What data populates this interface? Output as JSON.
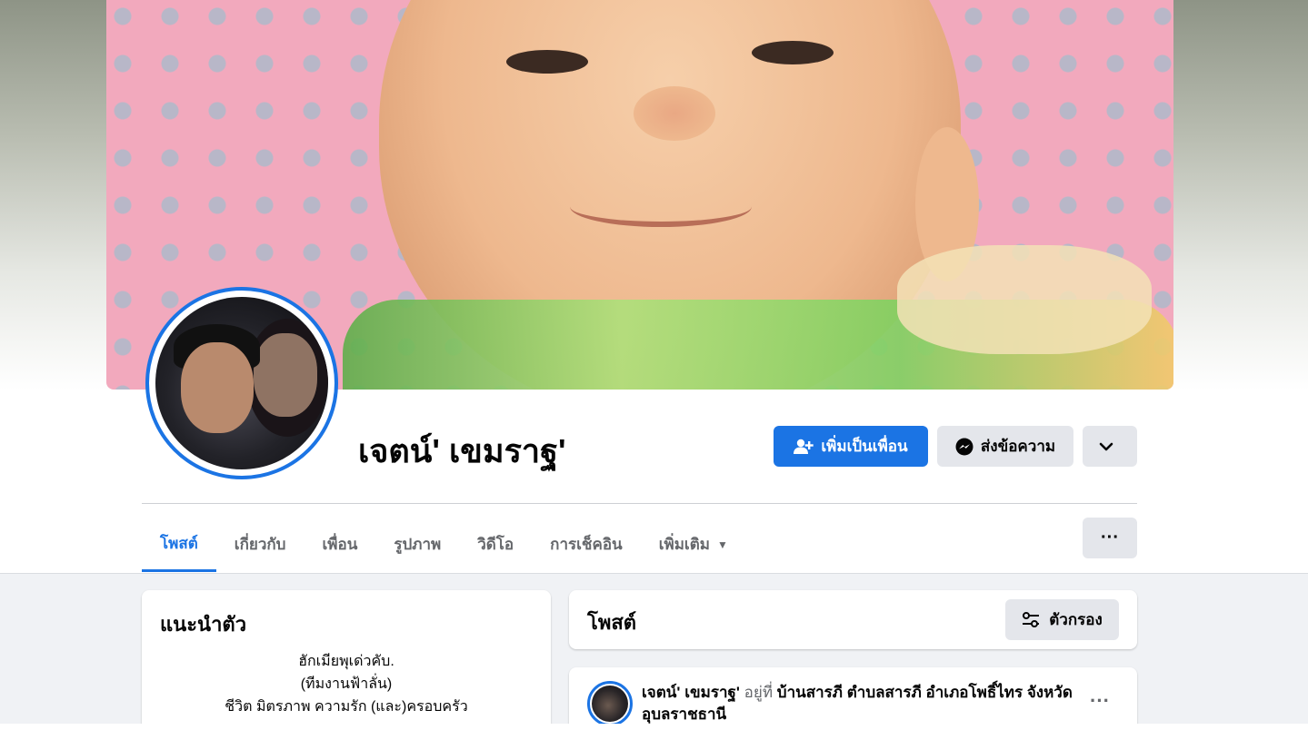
{
  "profile": {
    "name": "เจตน์' เขมราฐ'"
  },
  "actions": {
    "add_friend": "เพิ่มเป็นเพื่อน",
    "message": "ส่งข้อความ"
  },
  "tabs": [
    {
      "label": "โพสต์",
      "active": true
    },
    {
      "label": "เกี่ยวกับ"
    },
    {
      "label": "เพื่อน"
    },
    {
      "label": "รูปภาพ"
    },
    {
      "label": "วิดีโอ"
    },
    {
      "label": "การเช็คอิน"
    },
    {
      "label": "เพิ่มเติม"
    }
  ],
  "intro": {
    "title": "แนะนำตัว",
    "lines": [
      "ฮักเมียพุเด่วคับ.",
      "(ทีมงานฟ้าลั่น)",
      "ชีวิต มิตรภาพ ความรัก (และ)ครอบครัว"
    ]
  },
  "posts": {
    "title": "โพสต์",
    "filter_label": "ตัวกรอง"
  },
  "post": {
    "author": "เจตน์' เขมราฐ'",
    "at": "อยู่ที่",
    "place": "บ้านสารภี ตำบลสารภี อำเภอโพธิ์ไทร จังหวัดอุบลราชธานี"
  },
  "colors": {
    "accent": "#1b74e4",
    "button_gray": "#e4e6eb",
    "page_bg": "#f0f2f5"
  },
  "icons": {
    "add_friend": "person-plus-icon",
    "message": "messenger-icon",
    "dropdown": "chevron-down-icon",
    "more": "ellipsis-icon",
    "filter": "sliders-icon"
  }
}
